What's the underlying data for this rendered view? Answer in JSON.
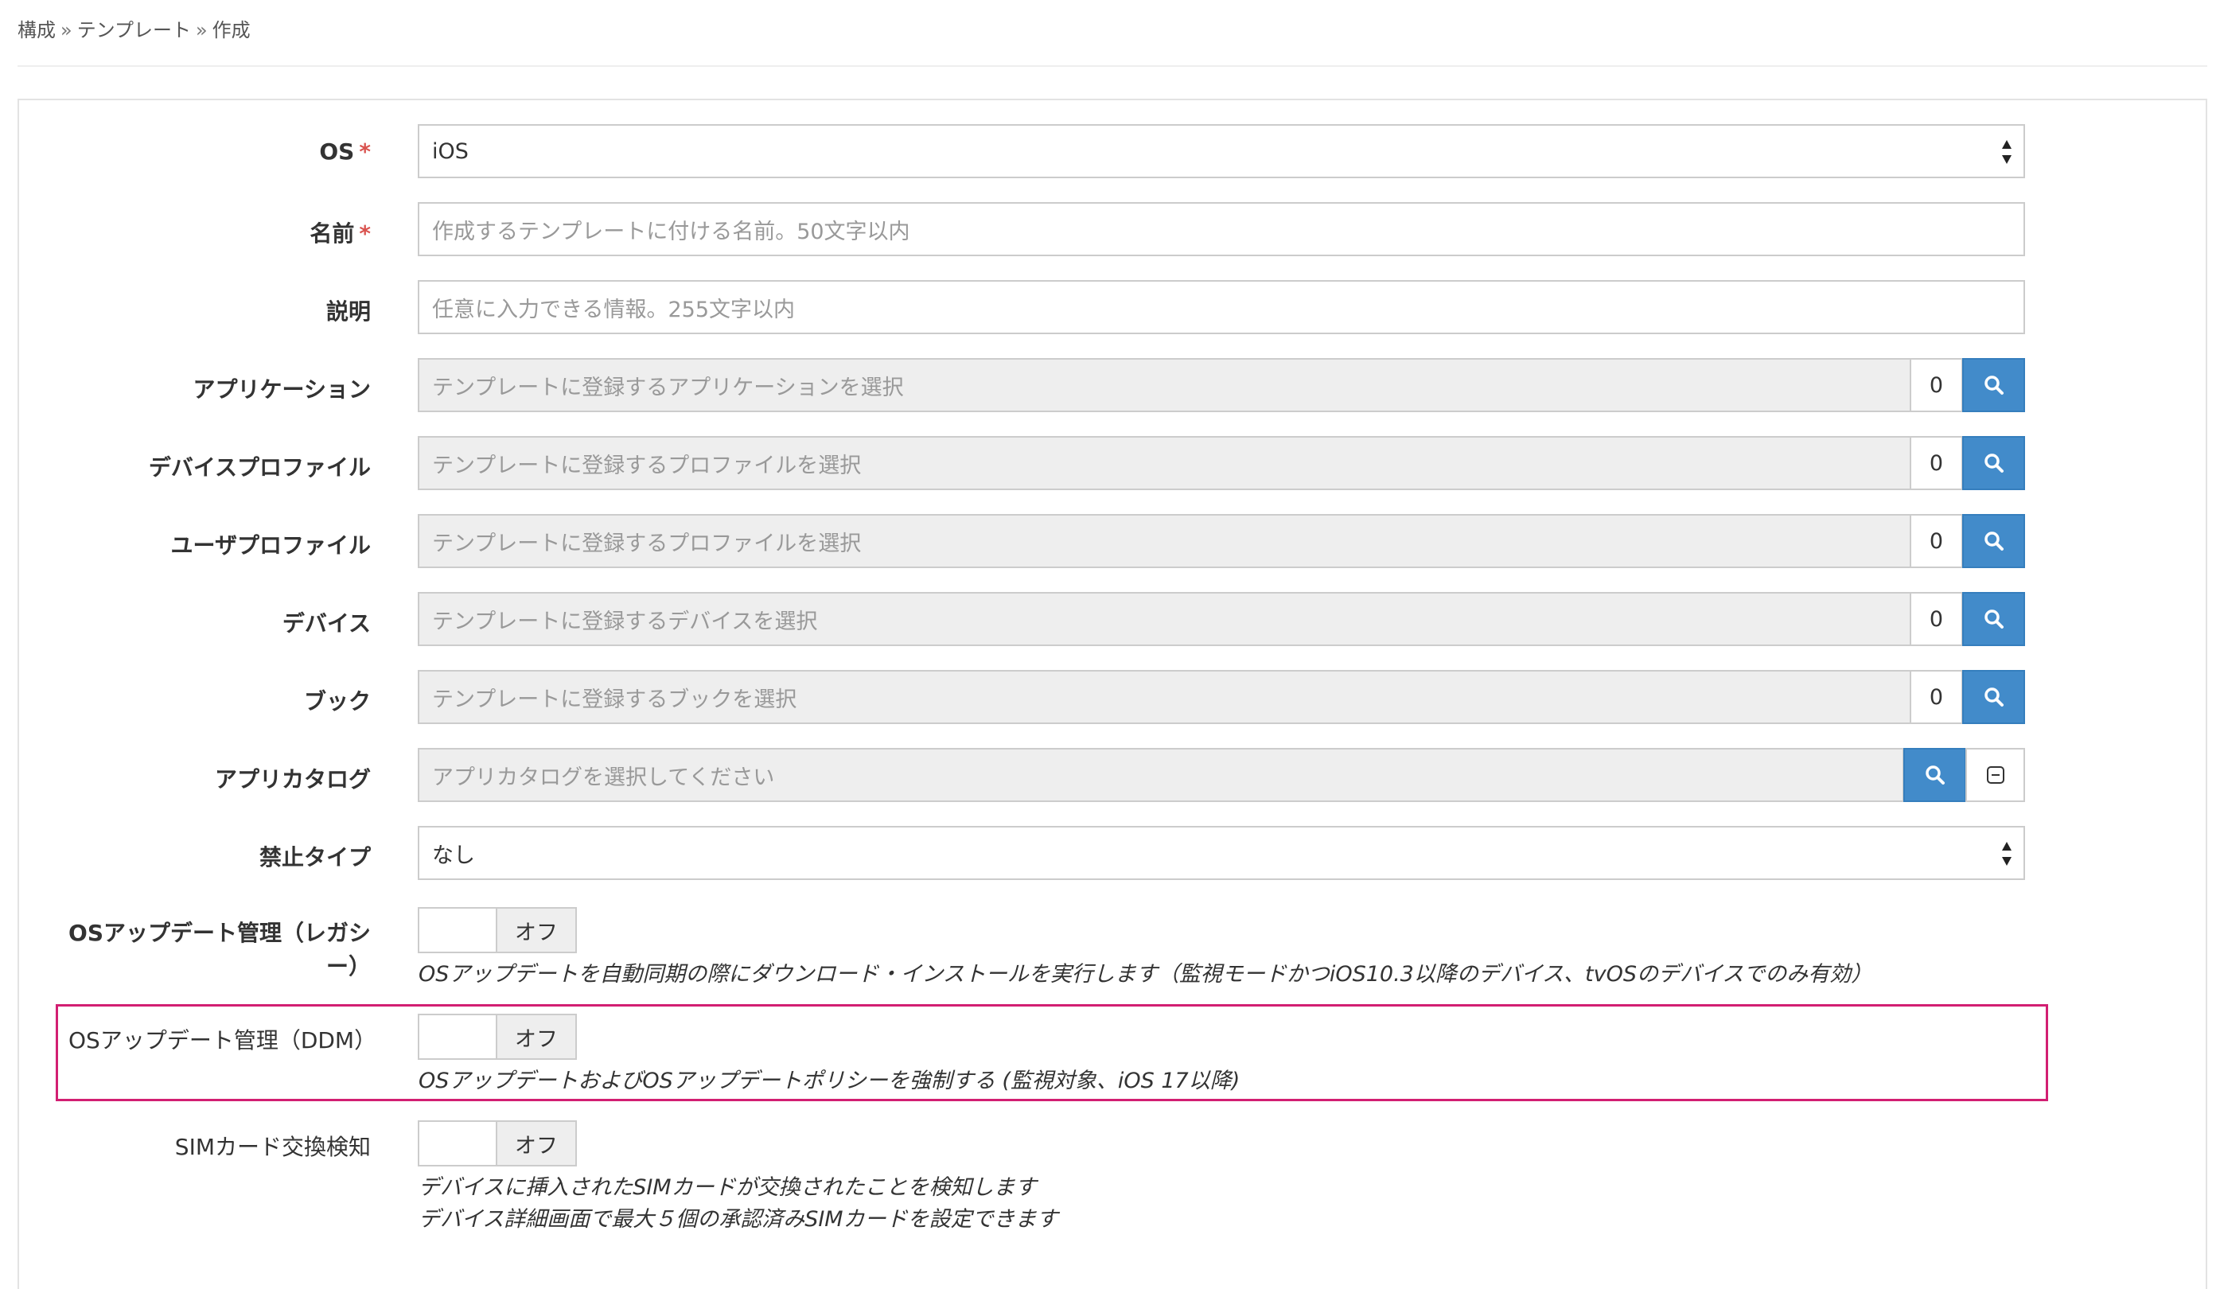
{
  "breadcrumb": [
    "構成",
    "テンプレート",
    "作成"
  ],
  "breadcrumb_sep": "»",
  "form": {
    "os": {
      "label": "OS",
      "required": "*",
      "value": "iOS"
    },
    "name": {
      "label": "名前",
      "required": "*",
      "placeholder": "作成するテンプレートに付ける名前。50文字以内"
    },
    "description": {
      "label": "説明",
      "placeholder": "任意に入力できる情報。255文字以内"
    },
    "applications": {
      "label": "アプリケーション",
      "placeholder": "テンプレートに登録するアプリケーションを選択",
      "count": "0"
    },
    "device_profile": {
      "label": "デバイスプロファイル",
      "placeholder": "テンプレートに登録するプロファイルを選択",
      "count": "0"
    },
    "user_profile": {
      "label": "ユーザプロファイル",
      "placeholder": "テンプレートに登録するプロファイルを選択",
      "count": "0"
    },
    "devices": {
      "label": "デバイス",
      "placeholder": "テンプレートに登録するデバイスを選択",
      "count": "0"
    },
    "books": {
      "label": "ブック",
      "placeholder": "テンプレートに登録するブックを選択",
      "count": "0"
    },
    "app_catalog": {
      "label": "アプリカタログ",
      "placeholder": "アプリカタログを選択してください"
    },
    "prohibit_type": {
      "label": "禁止タイプ",
      "value": "なし"
    },
    "os_update_legacy": {
      "label_line1": "OSアップデート管理（レガシ",
      "label_line2": "ー）",
      "state": "オフ",
      "help": "OSアップデートを自動同期の際にダウンロード・インストールを実行します（監視モードかつiOS10.3以降のデバイス、tvOSのデバイスでのみ有効）"
    },
    "os_update_ddm": {
      "label": "OSアップデート管理（DDM）",
      "state": "オフ",
      "help": "OSアップデートおよびOSアップデートポリシーを強制する (監視対象、iOS 17以降)"
    },
    "sim_change": {
      "label": "SIMカード交換検知",
      "state": "オフ",
      "help_line1": "デバイスに挿入されたSIMカードが交換されたことを検知します",
      "help_line2": "デバイス詳細画面で最大５個の承認済みSIMカードを設定できます"
    }
  },
  "icons": {
    "search": "search-icon",
    "minus": "minus-square-icon",
    "select": "select-arrows-icon"
  },
  "colors": {
    "primary": "#428bca",
    "required": "#d9534f",
    "highlight": "#d21f72"
  }
}
